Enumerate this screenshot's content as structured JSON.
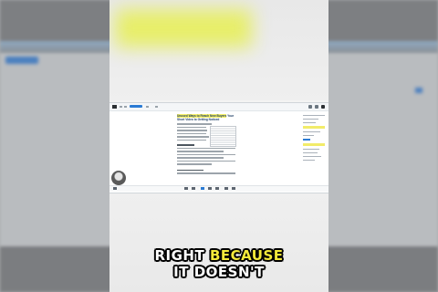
{
  "video": {
    "document": {
      "title_highlight": "Unused Ways to Reach New Buyers",
      "title_rest": "Your Short Video to Getting Noticed"
    }
  },
  "caption": {
    "line1_word1": "RIGHT",
    "line1_word2": "BECAUSE",
    "line2": "IT DOESN'T",
    "accent_color": "#f4e93a"
  }
}
